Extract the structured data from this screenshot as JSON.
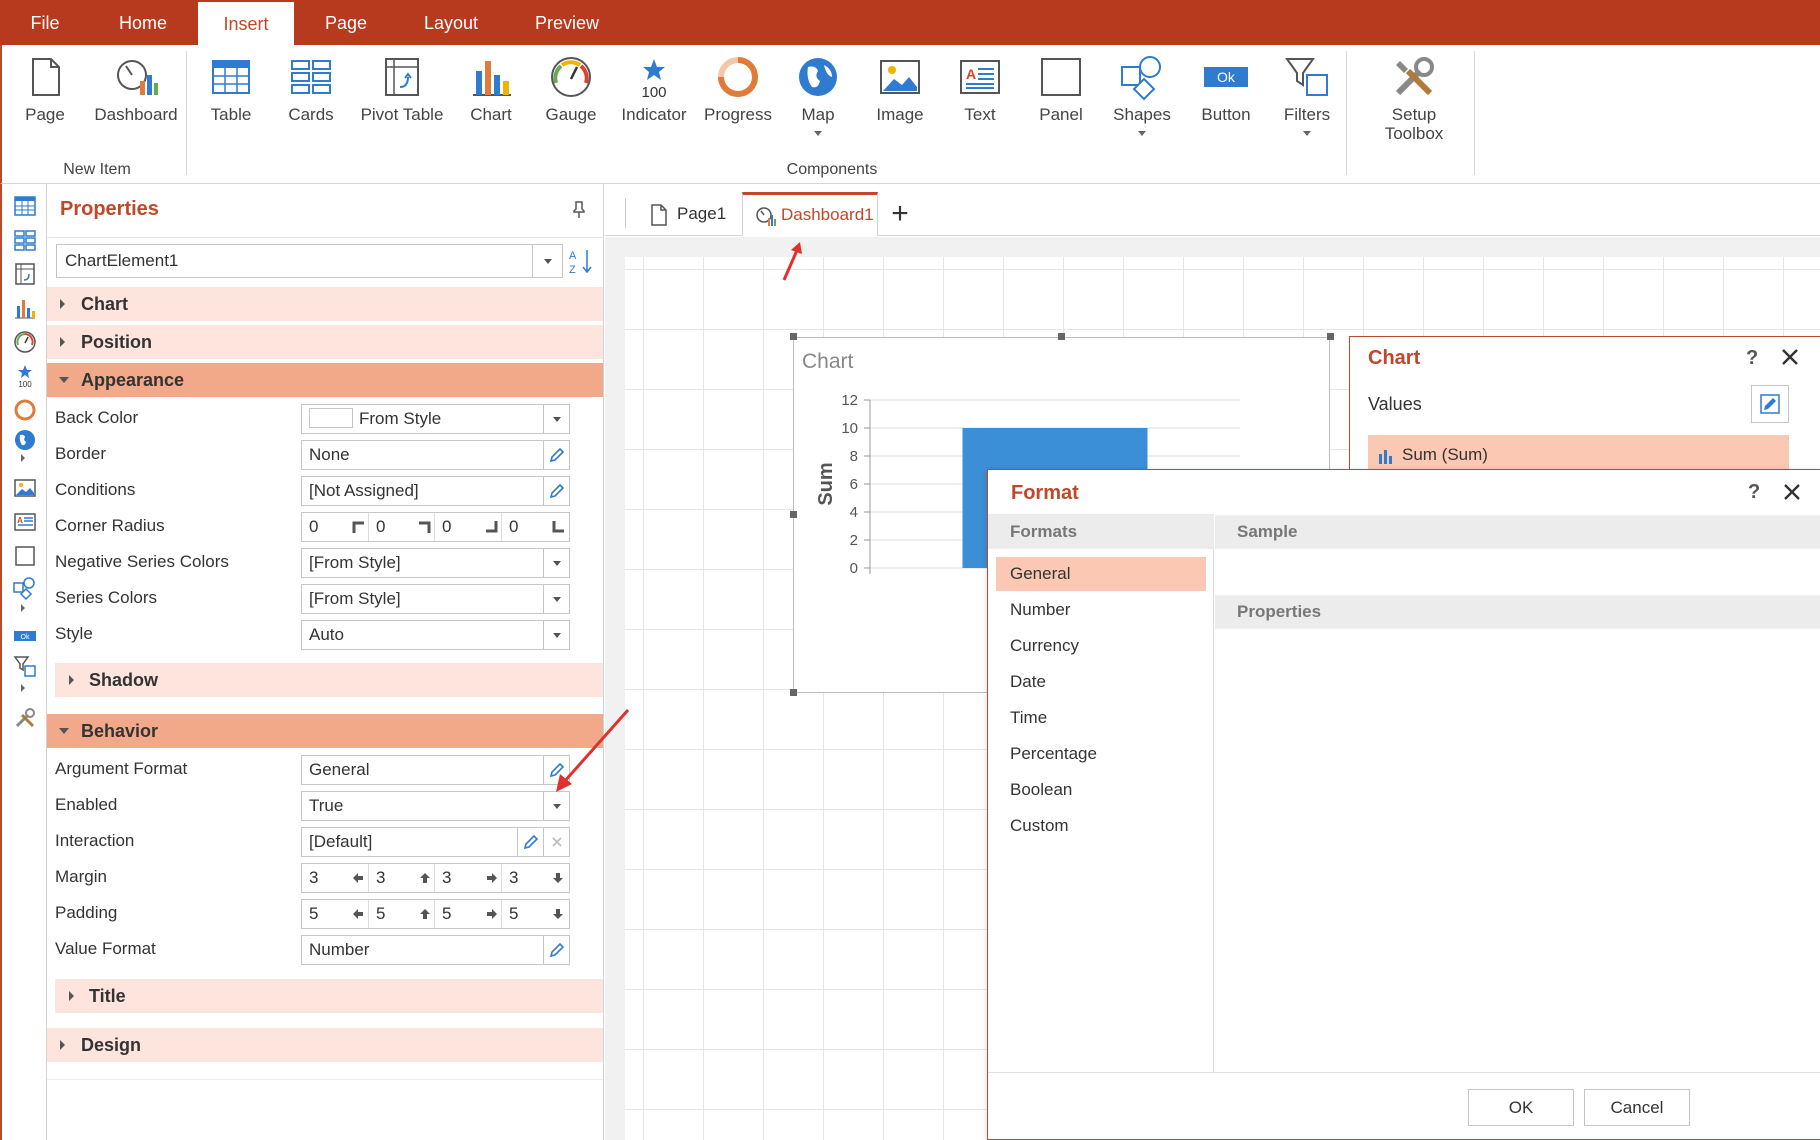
{
  "menu": {
    "tabs": [
      {
        "label": "File"
      },
      {
        "label": "Home"
      },
      {
        "label": "Insert"
      },
      {
        "label": "Page"
      },
      {
        "label": "Layout"
      },
      {
        "label": "Preview"
      }
    ],
    "active": "Insert"
  },
  "ribbon": {
    "new_item": {
      "page": "Page",
      "dashboard": "Dashboard",
      "group_label": "New Item"
    },
    "components": {
      "table": "Table",
      "cards": "Cards",
      "pivot": "Pivot Table",
      "chart": "Chart",
      "gauge": "Gauge",
      "indicator": "Indicator",
      "indicator_value": "100",
      "progress": "Progress",
      "map": "Map",
      "image": "Image",
      "text": "Text",
      "panel": "Panel",
      "shapes": "Shapes",
      "button": "Button",
      "button_icon_text": "Ok",
      "filters": "Filters",
      "group_label": "Components"
    },
    "setup": {
      "line1": "Setup",
      "line2": "Toolbox"
    }
  },
  "toolstrip": {
    "ok_text": "Ok",
    "indicator_value": "100"
  },
  "properties": {
    "title": "Properties",
    "element": "ChartElement1",
    "sections": {
      "chart": "Chart",
      "position": "Position",
      "appearance": "Appearance",
      "shadow": "Shadow",
      "behavior": "Behavior",
      "title": "Title",
      "design": "Design"
    },
    "appearance": {
      "back_color": {
        "label": "Back Color",
        "value": "From Style"
      },
      "border": {
        "label": "Border",
        "value": "None"
      },
      "conditions": {
        "label": "Conditions",
        "value": "[Not Assigned]"
      },
      "corner_radius": {
        "label": "Corner Radius",
        "values": [
          "0",
          "0",
          "0",
          "0"
        ]
      },
      "negative_series_colors": {
        "label": "Negative Series Colors",
        "value": "[From Style]"
      },
      "series_colors": {
        "label": "Series Colors",
        "value": "[From Style]"
      },
      "style": {
        "label": "Style",
        "value": "Auto"
      }
    },
    "behavior": {
      "argument_format": {
        "label": "Argument Format",
        "value": "General"
      },
      "enabled": {
        "label": "Enabled",
        "value": "True"
      },
      "interaction": {
        "label": "Interaction",
        "value": "[Default]"
      },
      "margin": {
        "label": "Margin",
        "values": [
          "3",
          "3",
          "3",
          "3"
        ]
      },
      "padding": {
        "label": "Padding",
        "values": [
          "5",
          "5",
          "5",
          "5"
        ]
      },
      "value_format": {
        "label": "Value Format",
        "value": "Number"
      }
    }
  },
  "tabs": {
    "page1": "Page1",
    "dashboard1": "Dashboard1",
    "add": "+"
  },
  "chart_element": {
    "title": "Chart"
  },
  "chart_data": {
    "type": "bar",
    "title": "Chart",
    "ylabel": "Sum",
    "xlabel": "",
    "ylim": [
      0,
      12
    ],
    "yticks": [
      "0",
      "2",
      "4",
      "6",
      "8",
      "10",
      "12"
    ],
    "values": [
      10
    ],
    "categories": [
      ""
    ],
    "bar_color": "#3a8fd6",
    "grid": true
  },
  "chart_panel": {
    "title": "Chart",
    "help": "?",
    "values_label": "Values",
    "item": "Sum (Sum)"
  },
  "format_dialog": {
    "title": "Format",
    "help": "?",
    "formats_header": "Formats",
    "sample_header": "Sample",
    "properties_header": "Properties",
    "formats": [
      "General",
      "Number",
      "Currency",
      "Date",
      "Time",
      "Percentage",
      "Boolean",
      "Custom"
    ],
    "selected": "General",
    "ok": "OK",
    "cancel": "Cancel"
  },
  "colors": {
    "accent": "#c0482a",
    "menubar": "#b83a1e",
    "section_open": "#f1a989",
    "section_closed": "#fde4dc",
    "selection": "#fac8b3",
    "icon_blue": "#2e7bcf"
  }
}
